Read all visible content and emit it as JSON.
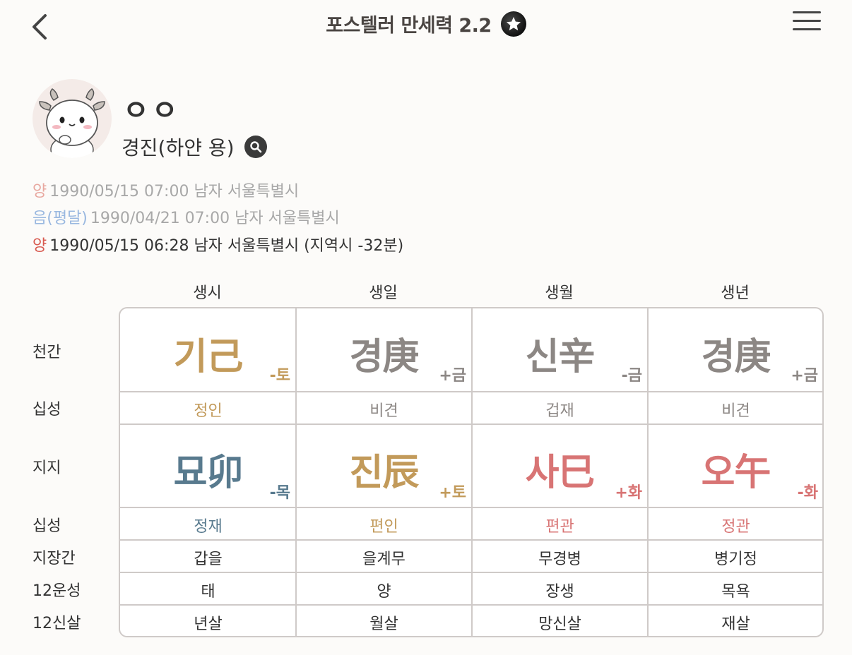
{
  "header": {
    "title": "포스텔러 만세력 2.2"
  },
  "profile": {
    "name": "ㅇㅇ",
    "subtitle": "경진(하얀 용)"
  },
  "info": [
    {
      "tag": "양",
      "text": "1990/05/15 07:00 남자 서울특별시"
    },
    {
      "tag": "음(평달)",
      "text": "1990/04/21 07:00 남자 서울특별시"
    },
    {
      "tag": "양",
      "text": "1990/05/15 06:28 남자 서울특별시 (지역시 -32분)"
    }
  ],
  "table": {
    "columns": [
      "생시",
      "생일",
      "생월",
      "생년"
    ],
    "row_labels": {
      "cheongan": "천간",
      "sipseong1": "십성",
      "jiji": "지지",
      "sipseong2": "십성",
      "jijanggan": "지장간",
      "unseong": "12운성",
      "sinsal": "12신살"
    },
    "cheongan": [
      {
        "char": "기己",
        "elem": "-토",
        "color": "#c29a5a"
      },
      {
        "char": "경庚",
        "elem": "+금",
        "color": "#8c8784"
      },
      {
        "char": "신辛",
        "elem": "-금",
        "color": "#8c8784"
      },
      {
        "char": "경庚",
        "elem": "+금",
        "color": "#8c8784"
      }
    ],
    "sipseong1": [
      {
        "text": "정인",
        "color": "#c29a5a"
      },
      {
        "text": "비견",
        "color": "#8c8784"
      },
      {
        "text": "겁재",
        "color": "#8c8784"
      },
      {
        "text": "비견",
        "color": "#8c8784"
      }
    ],
    "jiji": [
      {
        "char": "묘卯",
        "elem": "-목",
        "color": "#587a8e"
      },
      {
        "char": "진辰",
        "elem": "+토",
        "color": "#c29a5a"
      },
      {
        "char": "사巳",
        "elem": "+화",
        "color": "#d87474"
      },
      {
        "char": "오午",
        "elem": "-화",
        "color": "#d87474"
      }
    ],
    "sipseong2": [
      {
        "text": "정재",
        "color": "#587a8e"
      },
      {
        "text": "편인",
        "color": "#c29a5a"
      },
      {
        "text": "편관",
        "color": "#d87474"
      },
      {
        "text": "정관",
        "color": "#d87474"
      }
    ],
    "jijanggan": [
      "갑을",
      "을계무",
      "무경병",
      "병기정"
    ],
    "unseong": [
      "태",
      "양",
      "장생",
      "목욕"
    ],
    "sinsal": [
      "년살",
      "월살",
      "망신살",
      "재살"
    ]
  }
}
